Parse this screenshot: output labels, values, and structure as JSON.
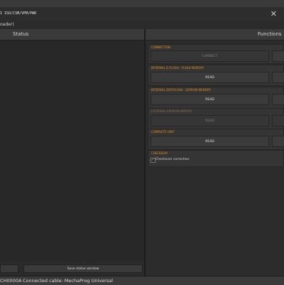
{
  "window": {
    "title_fragment": "I ISO/CSM/VPM/PWR",
    "close_glyph": "✕",
    "subtitle_fragment": "oader)"
  },
  "status_panel": {
    "title": "Status",
    "save_button_label": "Save status window"
  },
  "functions_panel": {
    "title": "Functions",
    "sections": [
      {
        "label": "CONNECTION",
        "enabled": true,
        "button_label": "CONNECT",
        "button_enabled": false
      },
      {
        "label": "INTERNAL D-FLASH - FLASH MEMORY",
        "enabled": true,
        "button_label": "READ",
        "button_enabled": true
      },
      {
        "label": "INTERNAL DATAFLASH - EEPROM MEMORY",
        "enabled": true,
        "button_label": "READ",
        "button_enabled": true
      },
      {
        "label": "EXTERNAL EEPROM MEMORY",
        "enabled": false,
        "button_label": "READ",
        "button_enabled": false
      },
      {
        "label": "COMPLETE UNIT",
        "enabled": true,
        "button_label": "READ",
        "button_enabled": true
      },
      {
        "label": "CHECKSUM",
        "enabled": true
      }
    ],
    "checksum": {
      "checked": true,
      "check_glyph": "✓",
      "label": "Checksum correction"
    }
  },
  "statusbar": {
    "code": "CH0000A",
    "cable": "Connected cable: MechaProg Universal"
  },
  "colors": {
    "accent_orange": "#e38a1e",
    "background": "#2b2b2b"
  }
}
